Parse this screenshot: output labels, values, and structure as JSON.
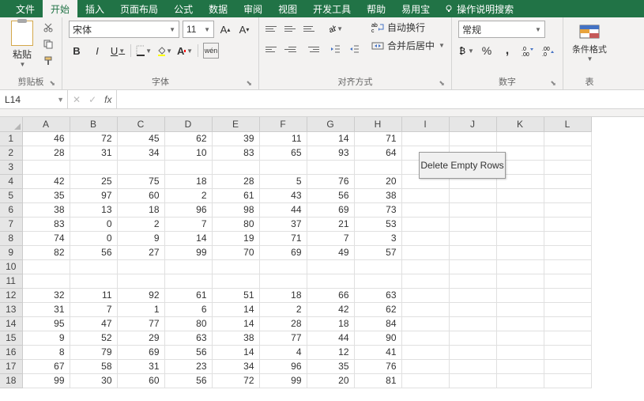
{
  "tabs": {
    "file": "文件",
    "home": "开始",
    "insert": "插入",
    "layout": "页面布局",
    "formulas": "公式",
    "data": "数据",
    "review": "审阅",
    "view": "视图",
    "dev": "开发工具",
    "help": "帮助",
    "yyb": "易用宝",
    "tellme": "操作说明搜索"
  },
  "groups": {
    "clipboard": "剪贴板",
    "font": "字体",
    "align": "对齐方式",
    "number": "数字",
    "styles": "表"
  },
  "clipboard": {
    "paste": "粘贴"
  },
  "font": {
    "name": "宋体",
    "size": "11",
    "b": "B",
    "i": "I",
    "u": "U",
    "ruby": "wén"
  },
  "align": {
    "wrap": "自动换行",
    "merge": "合并后居中"
  },
  "number": {
    "format": "常规",
    "percent": "%",
    "comma": ","
  },
  "styles": {
    "cond": "条件格式"
  },
  "namebox": "L14",
  "columns": [
    "A",
    "B",
    "C",
    "D",
    "E",
    "F",
    "G",
    "H",
    "I",
    "J",
    "K",
    "L"
  ],
  "rows": [
    [
      46,
      72,
      45,
      62,
      39,
      11,
      14,
      71
    ],
    [
      28,
      31,
      34,
      10,
      83,
      65,
      93,
      64
    ],
    [],
    [
      42,
      25,
      75,
      18,
      28,
      5,
      76,
      20
    ],
    [
      35,
      97,
      60,
      2,
      61,
      43,
      56,
      38
    ],
    [
      38,
      13,
      18,
      96,
      98,
      44,
      69,
      73
    ],
    [
      83,
      0,
      2,
      7,
      80,
      37,
      21,
      53
    ],
    [
      74,
      0,
      9,
      14,
      19,
      71,
      7,
      3
    ],
    [
      82,
      56,
      27,
      99,
      70,
      69,
      49,
      57
    ],
    [],
    [],
    [
      32,
      11,
      92,
      61,
      51,
      18,
      66,
      63
    ],
    [
      31,
      7,
      1,
      6,
      14,
      2,
      42,
      62
    ],
    [
      95,
      47,
      77,
      80,
      14,
      28,
      18,
      84
    ],
    [
      9,
      52,
      29,
      63,
      38,
      77,
      44,
      90
    ],
    [
      8,
      79,
      69,
      56,
      14,
      4,
      12,
      41
    ],
    [
      67,
      58,
      31,
      23,
      34,
      96,
      35,
      76
    ],
    [
      99,
      30,
      60,
      56,
      72,
      99,
      20,
      81
    ]
  ],
  "float_button": "Delete Empty Rows",
  "icons": {
    "cut": "scissors",
    "copy": "copy",
    "format_painter": "brush",
    "currency": "currency",
    "increase_dec": "increase-decimal",
    "decrease_dec": "decrease-decimal"
  }
}
